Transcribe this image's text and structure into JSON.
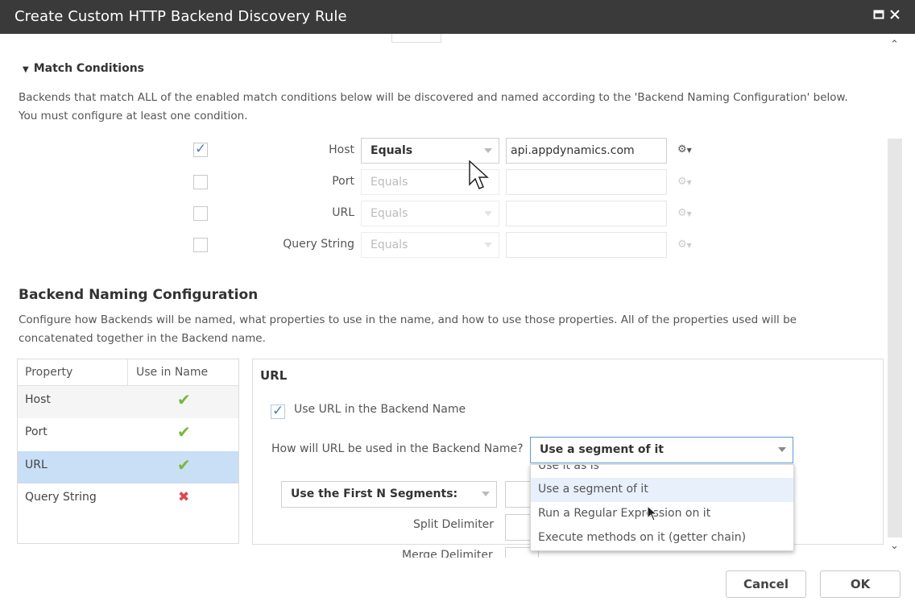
{
  "window": {
    "title": "Create Custom HTTP Backend Discovery Rule",
    "maximize_icon": "maximize-icon",
    "close_icon": "close-icon"
  },
  "match_conditions": {
    "header": "Match Conditions",
    "description_line1": "Backends that match ALL of the enabled match conditions below will be discovered and named according to the 'Backend Naming Configuration' below.",
    "description_line2": "You must configure at least one condition.",
    "rows": [
      {
        "label": "Host",
        "checked": true,
        "operator": "Equals",
        "value": "api.appdynamics.com"
      },
      {
        "label": "Port",
        "checked": false,
        "operator": "Equals",
        "value": ""
      },
      {
        "label": "URL",
        "checked": false,
        "operator": "Equals",
        "value": ""
      },
      {
        "label": "Query String",
        "checked": false,
        "operator": "Equals",
        "value": ""
      }
    ]
  },
  "naming": {
    "header": "Backend Naming Configuration",
    "description_line1": "Configure how Backends will be named, what properties to use in the name, and how to use those properties.  All of the properties used will be",
    "description_line2": "concatenated together in the Backend name.",
    "table": {
      "col_property": "Property",
      "col_use": "Use in Name",
      "rows": [
        {
          "name": "Host",
          "use": true
        },
        {
          "name": "Port",
          "use": true
        },
        {
          "name": "URL",
          "use": true,
          "selected": true
        },
        {
          "name": "Query String",
          "use": false
        }
      ]
    },
    "detail": {
      "title": "URL",
      "use_checkbox_label": "Use URL in the Backend Name",
      "how_label": "How will URL be used in the Backend Name?",
      "how_value": "Use a segment of it",
      "segments_select": "Use the First N Segments:",
      "split_label": "Split Delimiter",
      "merge_label": "Merge Delimiter"
    },
    "dropdown_options": [
      "Use it as is",
      "Use a segment of it",
      "Run a Regular Expression on it",
      "Execute methods on it (getter chain)"
    ]
  },
  "footer": {
    "cancel": "Cancel",
    "ok": "OK"
  },
  "colors": {
    "titlebar": "#3a3a3a",
    "check_ok": "#7ab835",
    "check_no": "#e0474c",
    "selected_row": "#c8dff5",
    "checkbox_tick": "#4a7fc0"
  }
}
